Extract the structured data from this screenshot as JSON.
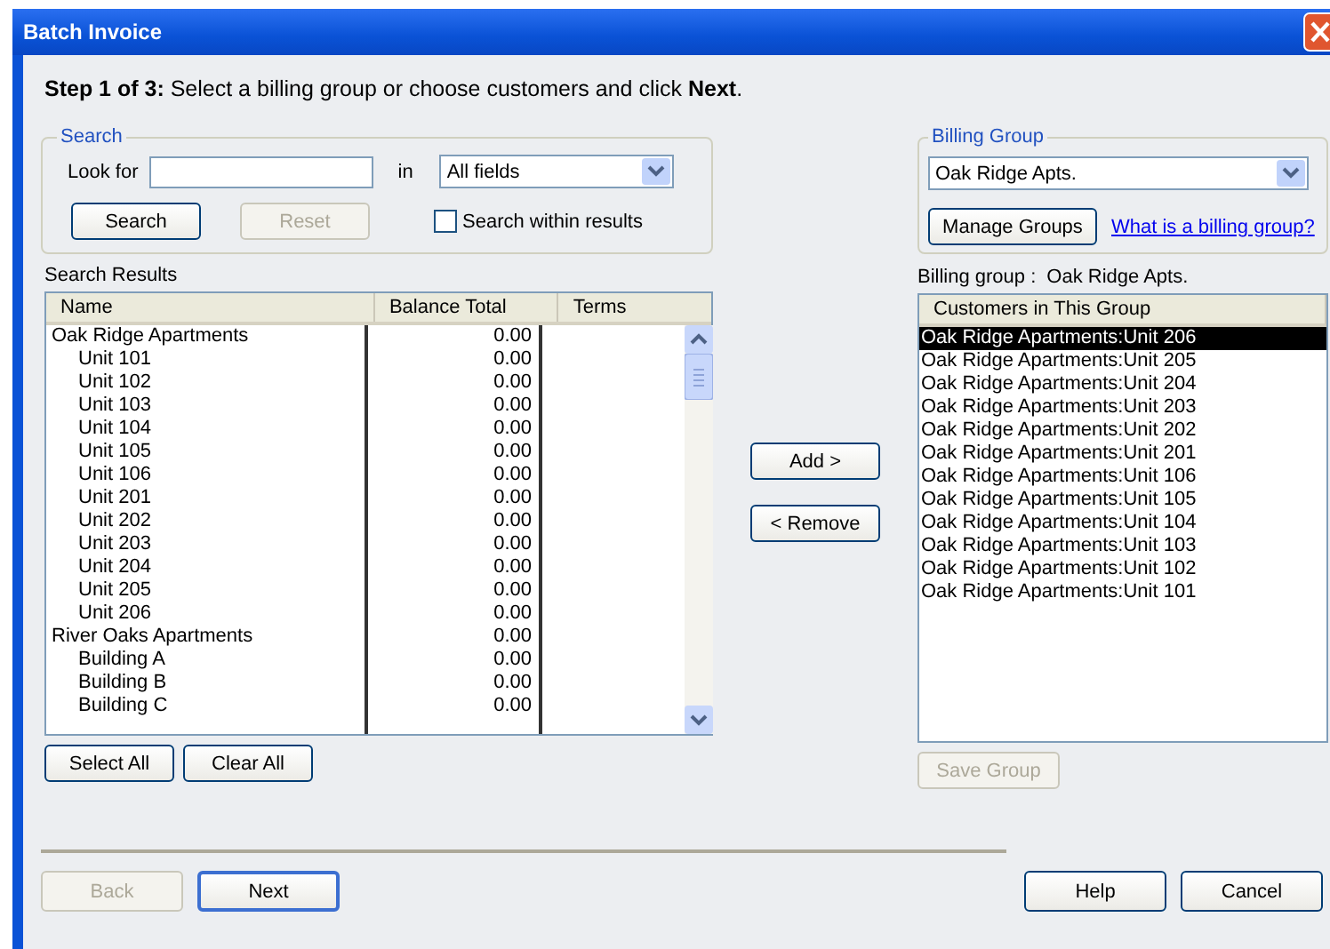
{
  "window": {
    "title": "Batch Invoice"
  },
  "instruction": "**Step 1 of 3:** Select a billing group or choose customers and click **Next**.",
  "search": {
    "title": "Search",
    "look_for_label": "Look for",
    "in_label": "in",
    "field": "All fields",
    "buttons": [
      {
        "label": "Search",
        "disabled": false
      },
      {
        "label": "Reset",
        "disabled": true
      }
    ],
    "within_results": {
      "label": "Search within results",
      "checked": false
    }
  },
  "billing_group": {
    "title": "Billing Group",
    "value": "Oak Ridge Apts.",
    "manage_button": "Manage Groups",
    "help_link": "What is a billing group?"
  },
  "results": {
    "title": "Search Results",
    "columns": [
      "Name",
      "Balance Total",
      "Terms"
    ],
    "rows": [
      {
        "name": "Oak Ridge Apartments",
        "balance": "0.00",
        "children": [
          {
            "name": "Unit 101",
            "balance": "0.00"
          },
          {
            "name": "Unit 102",
            "balance": "0.00"
          },
          {
            "name": "Unit 103",
            "balance": "0.00"
          },
          {
            "name": "Unit 104",
            "balance": "0.00"
          },
          {
            "name": "Unit 105",
            "balance": "0.00"
          },
          {
            "name": "Unit 106",
            "balance": "0.00"
          },
          {
            "name": "Unit 201",
            "balance": "0.00"
          },
          {
            "name": "Unit 202",
            "balance": "0.00"
          },
          {
            "name": "Unit 203",
            "balance": "0.00"
          },
          {
            "name": "Unit 204",
            "balance": "0.00"
          },
          {
            "name": "Unit 205",
            "balance": "0.00"
          },
          {
            "name": "Unit 206",
            "balance": "0.00"
          }
        ]
      },
      {
        "name": "River Oaks Apartments",
        "balance": "0.00",
        "children": [
          {
            "name": "Building A",
            "balance": "0.00"
          },
          {
            "name": "Building B",
            "balance": "0.00"
          },
          {
            "name": "Building C",
            "balance": "0.00"
          }
        ]
      }
    ],
    "buttons": [
      {
        "label": "Select All",
        "disabled": false
      },
      {
        "label": "Clear All",
        "disabled": false
      }
    ]
  },
  "transfer_buttons": [
    {
      "label": "Add >",
      "disabled": false
    },
    {
      "label": "< Remove",
      "disabled": false
    }
  ],
  "group": {
    "label": "Billing group :",
    "value": "Oak Ridge Apts.",
    "column": "Customers in This Group",
    "items": [
      {
        "name": "Oak Ridge Apartments:Unit 206",
        "selected": true
      },
      {
        "name": "Oak Ridge Apartments:Unit 205",
        "selected": false
      },
      {
        "name": "Oak Ridge Apartments:Unit 204",
        "selected": false
      },
      {
        "name": "Oak Ridge Apartments:Unit 203",
        "selected": false
      },
      {
        "name": "Oak Ridge Apartments:Unit 202",
        "selected": false
      },
      {
        "name": "Oak Ridge Apartments:Unit 201",
        "selected": false
      },
      {
        "name": "Oak Ridge Apartments:Unit 106",
        "selected": false
      },
      {
        "name": "Oak Ridge Apartments:Unit 105",
        "selected": false
      },
      {
        "name": "Oak Ridge Apartments:Unit 104",
        "selected": false
      },
      {
        "name": "Oak Ridge Apartments:Unit 103",
        "selected": false
      },
      {
        "name": "Oak Ridge Apartments:Unit 102",
        "selected": false
      },
      {
        "name": "Oak Ridge Apartments:Unit 101",
        "selected": false
      }
    ],
    "save_button": {
      "label": "Save Group",
      "disabled": true
    }
  },
  "footer": {
    "nav_buttons": [
      {
        "label": "Back",
        "disabled": true
      },
      {
        "label": "Next",
        "disabled": false
      }
    ],
    "buttons": [
      {
        "label": "Help",
        "disabled": false
      },
      {
        "label": "Cancel",
        "disabled": false
      }
    ]
  }
}
